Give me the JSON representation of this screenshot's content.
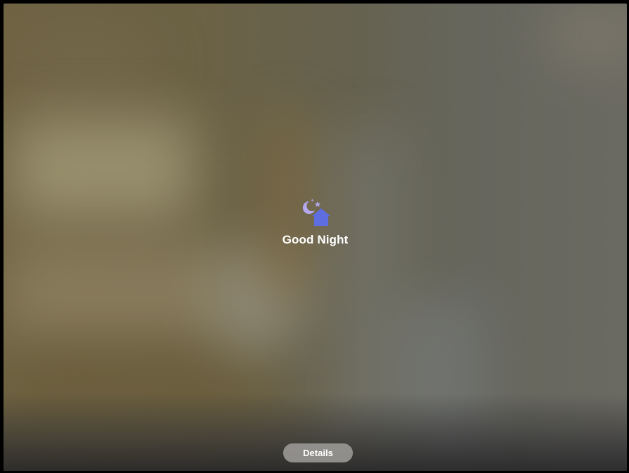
{
  "scene": {
    "title": "Good Night",
    "icon": "moon-stars-home-icon",
    "icon_color": "#5e6ee0",
    "moon_color": "#b4a8f0"
  },
  "footer": {
    "details_label": "Details"
  }
}
